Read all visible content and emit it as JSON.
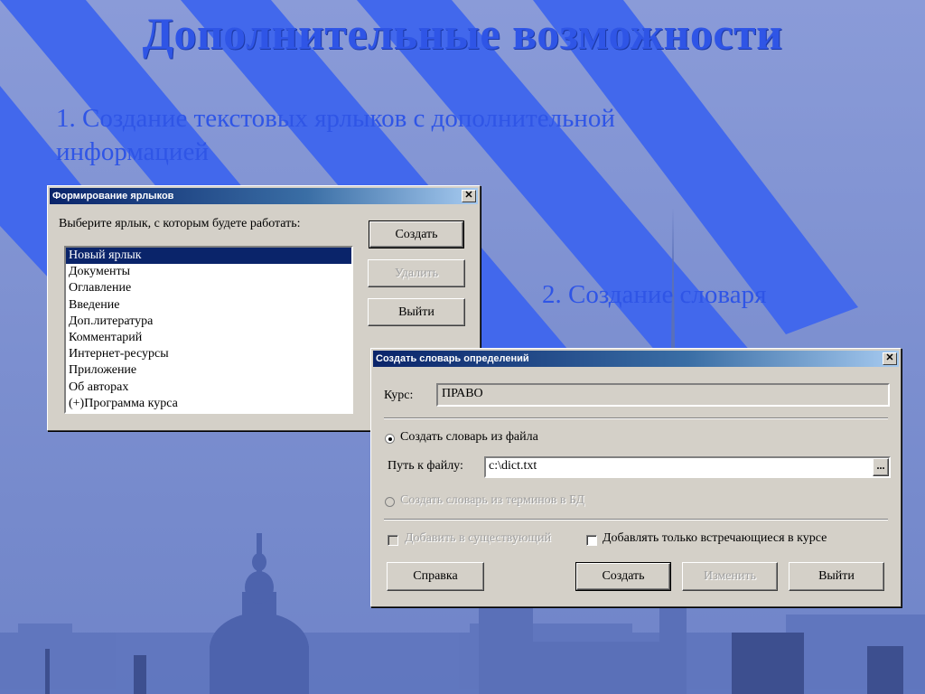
{
  "slide": {
    "title": "Дополнительные возможности",
    "point1": "1. Создание текстовых ярлыков с дополнительной информацией",
    "point2": "2. Создание словаря"
  },
  "colors": {
    "accent": "#2f55e6",
    "titlebar": "#0a246a",
    "dialog": "#d4d0c8"
  },
  "labels_dialog": {
    "title": "Формирование ярлыков",
    "close": "✕",
    "prompt": "Выберите ярлык, с которым будете работать:",
    "buttons": {
      "create": "Создать",
      "delete": "Удалить",
      "exit": "Выйти"
    },
    "items": [
      "Новый ярлык",
      "Документы",
      "Оглавление",
      "Введение",
      "Доп.литература",
      "Комментарий",
      "Интернет-ресурсы",
      "Приложение",
      "Об авторах",
      "(+)Программа курса"
    ],
    "selected_item": "Новый ярлык"
  },
  "dictionary_dialog": {
    "title": "Создать словарь определений",
    "close": "✕",
    "course_label": "Курс:",
    "course_value": "ПРАВО",
    "radio_file": "Создать словарь из файла",
    "path_label": "Путь к файлу:",
    "path_value": "c:\\dict.txt",
    "browse": "...",
    "radio_db": "Создать словарь из терминов в БД",
    "check_add_existing": "Добавить в существующий",
    "check_only_course": "Добавлять только встречающиеся в курсе",
    "buttons": {
      "help": "Справка",
      "create": "Создать",
      "modify": "Изменить",
      "exit": "Выйти"
    }
  }
}
